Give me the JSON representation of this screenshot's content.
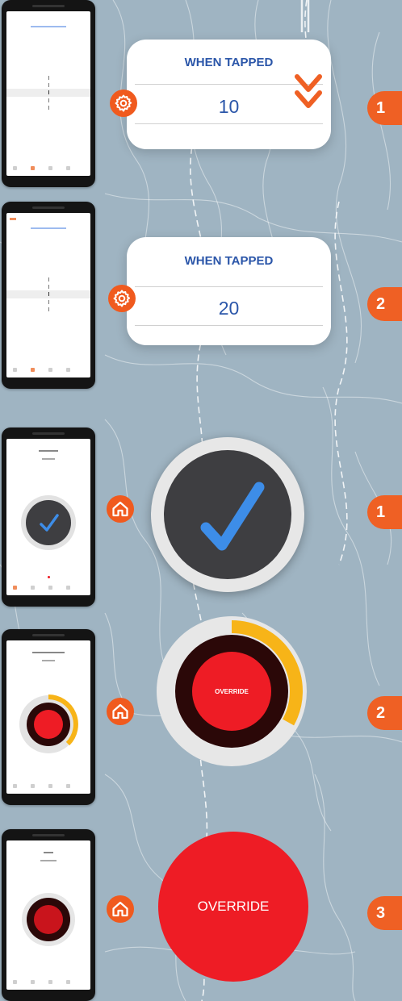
{
  "colors": {
    "accent_orange": "#ef6024",
    "title_blue": "#2b56a9",
    "map_background": "#9fb4c2",
    "override_red": "#ee1c25",
    "dial_dark": "#3e3e41",
    "check_blue": "#3d8de8",
    "progress_yellow": "#f7b418"
  },
  "timer_setting_1": {
    "title": "WHEN TAPPED",
    "value": "10",
    "step": "1",
    "icon": "gear-icon",
    "extra_icon": "double-chevron-down-icon"
  },
  "timer_setting_2": {
    "title": "WHEN TAPPED",
    "value": "20",
    "step": "2",
    "icon": "gear-icon"
  },
  "confirm_step": {
    "step": "1",
    "icon": "home-icon",
    "dial_icon": "checkmark-icon"
  },
  "override_progress_step": {
    "step": "2",
    "icon": "home-icon",
    "label": "OVERRIDE",
    "progress_fraction": 0.33
  },
  "override_step": {
    "step": "3",
    "icon": "home-icon",
    "label": "OVERRIDE"
  }
}
